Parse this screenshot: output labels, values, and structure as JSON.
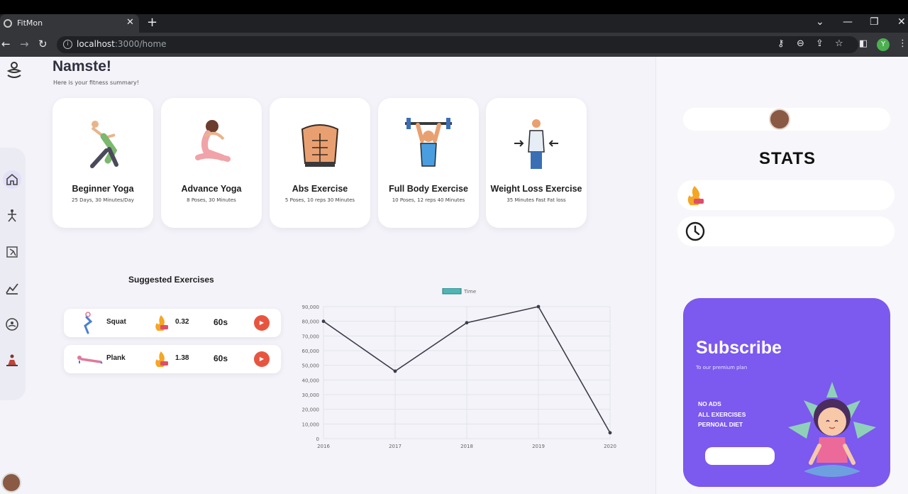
{
  "browser": {
    "tab_title": "FitMon",
    "tab_close": "✕",
    "new_tab": "+",
    "url_host": "localhost",
    "url_rest": ":3000/home",
    "profile_initial": "Y"
  },
  "header": {
    "greeting": "Namste!",
    "subtitle": "Here is your fitness summary!"
  },
  "sidebar": {
    "items": [
      {
        "icon": "home-icon",
        "active": true
      },
      {
        "icon": "yoga-pose-icon",
        "active": false
      },
      {
        "icon": "exercise-icon",
        "active": false
      },
      {
        "icon": "progress-chart-icon",
        "active": false
      },
      {
        "icon": "meditation-icon",
        "active": false
      },
      {
        "icon": "workout-icon",
        "active": false
      }
    ]
  },
  "cards": [
    {
      "title": "Beginner Yoga",
      "subtitle": "25 Days, 30 Minutes/Day",
      "icon": "beginner-yoga-illustration"
    },
    {
      "title": "Advance Yoga",
      "subtitle": "8 Poses, 30 Minutes",
      "icon": "advance-yoga-illustration"
    },
    {
      "title": "Abs Exercise",
      "subtitle": "5 Poses, 10 reps 30 Minutes",
      "icon": "abs-illustration"
    },
    {
      "title": "Full Body Exercise",
      "subtitle": "10 Poses, 12 reps 40 Minutes",
      "icon": "full-body-illustration"
    },
    {
      "title": "Weight Loss Exercise",
      "subtitle": "35 Minutes Fast Fat loss",
      "icon": "weight-loss-illustration"
    }
  ],
  "suggested": {
    "title": "Suggested Exercises",
    "items": [
      {
        "name": "Squat",
        "calories": "0.32",
        "duration": "60s"
      },
      {
        "name": "Plank",
        "calories": "1.38",
        "duration": "60s"
      }
    ]
  },
  "chart_data": {
    "type": "line",
    "title": "",
    "legend": [
      "Time"
    ],
    "legend_position": "top-center",
    "x": [
      "2016",
      "2017",
      "2018",
      "2019",
      "2020"
    ],
    "series": [
      {
        "name": "Time",
        "values": [
          80000,
          46000,
          79000,
          90000,
          4000
        ]
      }
    ],
    "yticks": [
      "0",
      "10,000",
      "20,000",
      "30,000",
      "40,000",
      "50,000",
      "60,000",
      "70,000",
      "80,000",
      "90,000"
    ],
    "ylim": [
      0,
      90000
    ],
    "grid": true,
    "line_color": "#3d3d4a",
    "legend_color": "#4fb5b5"
  },
  "stats": {
    "title": "STATS"
  },
  "subscribe": {
    "title": "Subscribe",
    "tagline": "To our premium plan",
    "features": [
      "NO ADS",
      "ALL EXERCISES",
      "PERNOAL DIET"
    ],
    "bg_color": "#7c59ef"
  },
  "flame_badge": "kcal"
}
